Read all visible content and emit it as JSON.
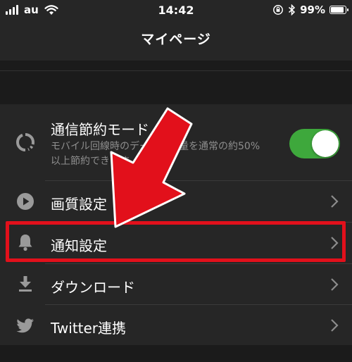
{
  "status_bar": {
    "carrier": "au",
    "time": "14:42",
    "battery_percent": "99%",
    "battery_level": 0.99
  },
  "nav": {
    "title": "マイページ"
  },
  "settings": {
    "data_saver": {
      "label": "通信節約モード",
      "description": "モバイル回線時のデータ使用量を通常の約50%以上節約できます",
      "enabled": true,
      "icon": "circle-dashed-icon"
    },
    "quality": {
      "label": "画質設定",
      "icon": "play-circle-icon"
    },
    "notifications": {
      "label": "通知設定",
      "icon": "bell-icon"
    },
    "download": {
      "label": "ダウンロード",
      "icon": "download-icon"
    },
    "twitter": {
      "label": "Twitter連携",
      "icon": "twitter-bird-icon"
    }
  },
  "colors": {
    "background": "#262626",
    "toggle_on": "#3ea83c",
    "annotation_red": "#e2101b"
  }
}
